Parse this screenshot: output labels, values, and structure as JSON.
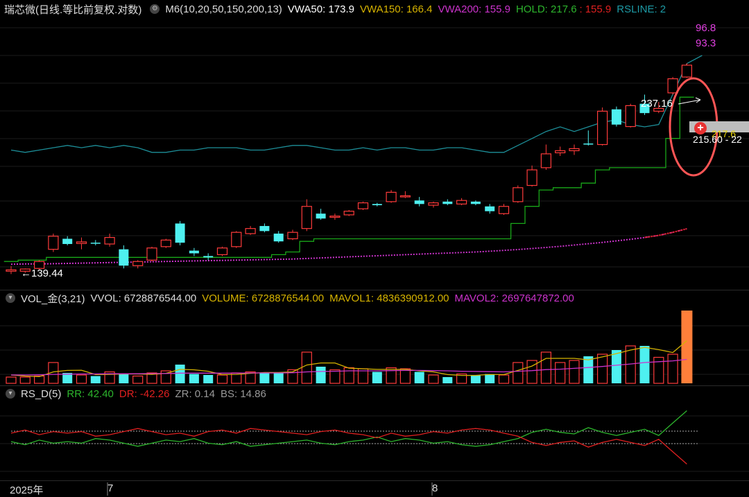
{
  "colors": {
    "up": "#ff3b3b",
    "down": "#4ef0f0",
    "hold": "#19a719",
    "rsline": "#1d8f99",
    "vwa50": "#ffffff",
    "vwa150": "#d6b300",
    "vwa200": "#cc33cc",
    "mavol1": "#d6b300",
    "mavol2": "#cc33cc",
    "rr": "#2db52d",
    "dr": "#e02020",
    "last_bar": "#ff7f3a",
    "annotation_circle": "#ff5555"
  },
  "header_main": {
    "title": "瑞芯微(日线.等比前复权.对数)",
    "m6_label": "M6(10,20,50,150,200,13)",
    "vwa50": "VWA50: 173.9",
    "vwa150": "VWA150: 166.4",
    "vwa200": "VWA200: 155.9",
    "hold": "HOLD: 217.6",
    "hold_sep": ":",
    "hold2": "155.9",
    "rsline": "RSLINE: 2"
  },
  "header_vol": {
    "title": "VOL_金(3,21)",
    "vvol": "VVOL: 6728876544.00",
    "volume": "VOLUME: 6728876544.00",
    "mavol1": "MAVOL1: 4836390912.00",
    "mavol2": "MAVOL2: 2697647872.00"
  },
  "header_rs": {
    "title": "RS_D(5)",
    "rr": "RR: 42.40",
    "dr": "DR: -42.26",
    "zr": "ZR: 0.14",
    "bs": "BS: 14.86"
  },
  "annotations": {
    "low_price": "←139.44",
    "high_price": "237.16",
    "rs_value_1": "96.8",
    "rs_value_2": "93.3",
    "crosshair_label": "215.60 - 22",
    "hold_tag": "217.6"
  },
  "x_axis_labels": [
    "2025年",
    "7",
    "8"
  ],
  "chart_data": [
    {
      "type": "candlestick",
      "title": "瑞芯微(日线.等比前复权.对数)",
      "candles": [
        {
          "o": 140,
          "h": 141.8,
          "l": 139,
          "c": 140.5,
          "up": true
        },
        {
          "o": 140,
          "h": 141,
          "l": 139.44,
          "c": 140.8,
          "up": true
        },
        {
          "o": 141,
          "h": 144,
          "l": 140.5,
          "c": 143.5,
          "up": true
        },
        {
          "o": 148,
          "h": 154,
          "l": 147,
          "c": 153,
          "up": true
        },
        {
          "o": 152,
          "h": 153,
          "l": 149.5,
          "c": 150,
          "up": false
        },
        {
          "o": 150.2,
          "h": 152.5,
          "l": 148,
          "c": 150.8,
          "up": true
        },
        {
          "o": 150.5,
          "h": 151.5,
          "l": 149.5,
          "c": 150.3,
          "up": false
        },
        {
          "o": 150,
          "h": 154,
          "l": 149,
          "c": 152.5,
          "up": true
        },
        {
          "o": 148,
          "h": 149.5,
          "l": 141,
          "c": 142,
          "up": false
        },
        {
          "o": 142,
          "h": 144,
          "l": 141,
          "c": 143.5,
          "up": true
        },
        {
          "o": 144,
          "h": 149,
          "l": 143.5,
          "c": 148.5,
          "up": true
        },
        {
          "o": 149,
          "h": 152,
          "l": 148.5,
          "c": 151.5,
          "up": true
        },
        {
          "o": 158,
          "h": 159,
          "l": 149.5,
          "c": 150.5,
          "up": false
        },
        {
          "o": 147.5,
          "h": 148.5,
          "l": 145.5,
          "c": 146.5,
          "up": false
        },
        {
          "o": 145.5,
          "h": 146.5,
          "l": 144,
          "c": 145,
          "up": false
        },
        {
          "o": 146,
          "h": 149,
          "l": 145.5,
          "c": 148.5,
          "up": true
        },
        {
          "o": 149,
          "h": 155,
          "l": 148.5,
          "c": 154.5,
          "up": true
        },
        {
          "o": 154,
          "h": 157,
          "l": 153.5,
          "c": 156,
          "up": true
        },
        {
          "o": 157,
          "h": 158,
          "l": 154.5,
          "c": 155,
          "up": false
        },
        {
          "o": 154,
          "h": 155,
          "l": 150.5,
          "c": 151,
          "up": false
        },
        {
          "o": 152,
          "h": 155.5,
          "l": 151.5,
          "c": 154.5,
          "up": true
        },
        {
          "o": 156,
          "h": 168,
          "l": 155,
          "c": 165,
          "up": true
        },
        {
          "o": 162,
          "h": 164,
          "l": 159.5,
          "c": 160,
          "up": false
        },
        {
          "o": 160.5,
          "h": 162,
          "l": 159.5,
          "c": 161,
          "up": true
        },
        {
          "o": 161.5,
          "h": 163.5,
          "l": 161,
          "c": 163,
          "up": true
        },
        {
          "o": 164,
          "h": 167,
          "l": 163.5,
          "c": 166.5,
          "up": true
        },
        {
          "o": 166,
          "h": 166.5,
          "l": 165,
          "c": 165.5,
          "up": false
        },
        {
          "o": 167,
          "h": 172,
          "l": 166.5,
          "c": 171,
          "up": true
        },
        {
          "o": 169,
          "h": 171.5,
          "l": 168.5,
          "c": 169.5,
          "up": true
        },
        {
          "o": 167.5,
          "h": 169,
          "l": 165,
          "c": 166,
          "up": false
        },
        {
          "o": 165.5,
          "h": 167,
          "l": 164.5,
          "c": 166.5,
          "up": true
        },
        {
          "o": 167,
          "h": 168,
          "l": 165.5,
          "c": 166,
          "up": false
        },
        {
          "o": 166,
          "h": 168.5,
          "l": 165.5,
          "c": 167.5,
          "up": true
        },
        {
          "o": 167,
          "h": 167.5,
          "l": 165.5,
          "c": 166,
          "up": false
        },
        {
          "o": 165,
          "h": 166,
          "l": 162,
          "c": 163,
          "up": false
        },
        {
          "o": 162,
          "h": 166,
          "l": 161.5,
          "c": 165,
          "up": true
        },
        {
          "o": 167,
          "h": 174,
          "l": 166.5,
          "c": 173,
          "up": true
        },
        {
          "o": 174,
          "h": 183,
          "l": 173.5,
          "c": 181,
          "up": true
        },
        {
          "o": 182,
          "h": 193,
          "l": 181,
          "c": 188.5,
          "up": true
        },
        {
          "o": 189,
          "h": 192,
          "l": 187.5,
          "c": 190,
          "up": true
        },
        {
          "o": 190,
          "h": 193,
          "l": 188,
          "c": 191,
          "up": true
        },
        {
          "o": 193,
          "h": 200,
          "l": 192.5,
          "c": 193.5,
          "up": false
        },
        {
          "o": 193,
          "h": 212,
          "l": 192.5,
          "c": 210,
          "up": true
        },
        {
          "o": 211,
          "h": 212.5,
          "l": 202,
          "c": 203,
          "up": false
        },
        {
          "o": 202,
          "h": 214,
          "l": 201.5,
          "c": 213,
          "up": true
        },
        {
          "o": 214,
          "h": 219,
          "l": 208,
          "c": 209,
          "up": false
        },
        {
          "o": 210,
          "h": 215,
          "l": 209,
          "c": 211.5,
          "up": true
        },
        {
          "o": 220,
          "h": 229,
          "l": 219,
          "c": 228,
          "up": true
        },
        {
          "o": 229,
          "h": 237.16,
          "l": 228.5,
          "c": 236,
          "up": true
        }
      ],
      "hold": [
        143.5,
        144,
        144,
        145,
        145,
        145,
        145,
        145,
        145,
        145,
        145,
        145,
        145,
        145,
        145,
        145,
        145,
        145,
        145,
        146,
        147,
        151,
        152,
        152,
        152,
        152,
        152,
        152,
        152,
        152,
        152,
        152,
        152,
        152,
        152,
        152,
        158,
        165,
        172,
        173,
        173,
        175,
        181,
        182,
        182,
        182,
        182,
        196,
        217.6
      ],
      "vwa200": [
        142.5,
        142.6,
        142.6,
        142.7,
        142.8,
        142.9,
        143,
        143.1,
        143.2,
        143.3,
        143.4,
        143.5,
        143.6,
        143.7,
        143.8,
        143.9,
        144,
        144.1,
        144.2,
        144.3,
        144.4,
        144.6,
        144.8,
        145,
        145.2,
        145.4,
        145.6,
        145.8,
        146,
        146.2,
        146.4,
        146.6,
        146.8,
        147,
        147.3,
        147.6,
        147.9,
        148.3,
        148.7,
        149.1,
        149.6,
        150.1,
        150.6,
        151.2,
        151.8,
        152.5,
        153.3,
        154.5,
        155.9
      ],
      "rsline": [
        56,
        55,
        56,
        57,
        58,
        57,
        58,
        57,
        58,
        57,
        55,
        55,
        56,
        56,
        57,
        57,
        57,
        56,
        56,
        57,
        58,
        58,
        57,
        56,
        56,
        57,
        56,
        57,
        57,
        56,
        56,
        57,
        57,
        56,
        55,
        55,
        58,
        61,
        64,
        66,
        64,
        66,
        68,
        69,
        67,
        66,
        67,
        80,
        93.3
      ]
    },
    {
      "type": "bar",
      "title": "VOL_金(3,21)",
      "volume": [
        0.3,
        0.3,
        0.35,
        1.0,
        0.5,
        0.4,
        0.35,
        0.55,
        0.45,
        0.35,
        0.5,
        0.6,
        0.9,
        0.45,
        0.4,
        0.4,
        0.5,
        0.55,
        0.5,
        0.5,
        0.65,
        1.5,
        0.8,
        0.65,
        0.75,
        0.7,
        0.55,
        0.75,
        0.7,
        0.55,
        0.4,
        0.3,
        0.45,
        0.4,
        0.45,
        0.4,
        1.0,
        1.1,
        1.5,
        1.0,
        1.1,
        1.3,
        1.4,
        1.6,
        1.8,
        1.8,
        1.25,
        1.4,
        3.5
      ],
      "mavol1": [
        0.4,
        0.35,
        0.32,
        0.55,
        0.62,
        0.63,
        0.42,
        0.43,
        0.45,
        0.45,
        0.43,
        0.48,
        0.67,
        0.65,
        0.58,
        0.42,
        0.43,
        0.48,
        0.52,
        0.52,
        0.55,
        0.88,
        0.98,
        0.98,
        0.73,
        0.7,
        0.67,
        0.67,
        0.67,
        0.6,
        0.55,
        0.42,
        0.38,
        0.38,
        0.43,
        0.42,
        0.62,
        0.83,
        1.2,
        1.2,
        1.2,
        1.13,
        1.27,
        1.43,
        1.6,
        1.73,
        1.62,
        1.48,
        2.05
      ],
      "mavol2": [
        0.4,
        0.4,
        0.41,
        0.43,
        0.44,
        0.45,
        0.45,
        0.46,
        0.46,
        0.46,
        0.47,
        0.47,
        0.49,
        0.49,
        0.49,
        0.49,
        0.49,
        0.5,
        0.5,
        0.5,
        0.51,
        0.55,
        0.57,
        0.58,
        0.6,
        0.6,
        0.6,
        0.61,
        0.62,
        0.62,
        0.61,
        0.6,
        0.58,
        0.57,
        0.56,
        0.55,
        0.58,
        0.61,
        0.66,
        0.68,
        0.72,
        0.76,
        0.81,
        0.87,
        0.93,
        1.0,
        1.04,
        1.08,
        1.15
      ],
      "ymax": 3.5
    },
    {
      "type": "line",
      "title": "RS_D(5)",
      "rr": [
        48,
        46,
        49,
        47,
        48,
        47,
        50,
        49,
        47,
        45,
        47,
        49,
        48,
        50,
        47,
        46,
        48,
        45,
        46,
        47,
        48,
        49,
        47,
        46,
        48,
        49,
        51,
        48,
        50,
        49,
        47,
        48,
        46,
        45,
        46,
        48,
        50,
        54,
        56,
        54,
        53,
        57,
        54,
        52,
        54,
        56,
        52,
        60,
        68
      ],
      "dr": [
        -48,
        -46,
        -49,
        -47,
        -48,
        -47,
        -50,
        -49,
        -47,
        -45,
        -47,
        -49,
        -48,
        -50,
        -47,
        -46,
        -48,
        -45,
        -46,
        -47,
        -48,
        -49,
        -47,
        -46,
        -48,
        -49,
        -51,
        -48,
        -50,
        -49,
        -47,
        -48,
        -46,
        -45,
        -46,
        -48,
        -50,
        -54,
        -56,
        -54,
        -53,
        -57,
        -54,
        -52,
        -54,
        -56,
        -52,
        -60,
        -68
      ],
      "ref_lines": [
        53,
        47
      ]
    }
  ]
}
